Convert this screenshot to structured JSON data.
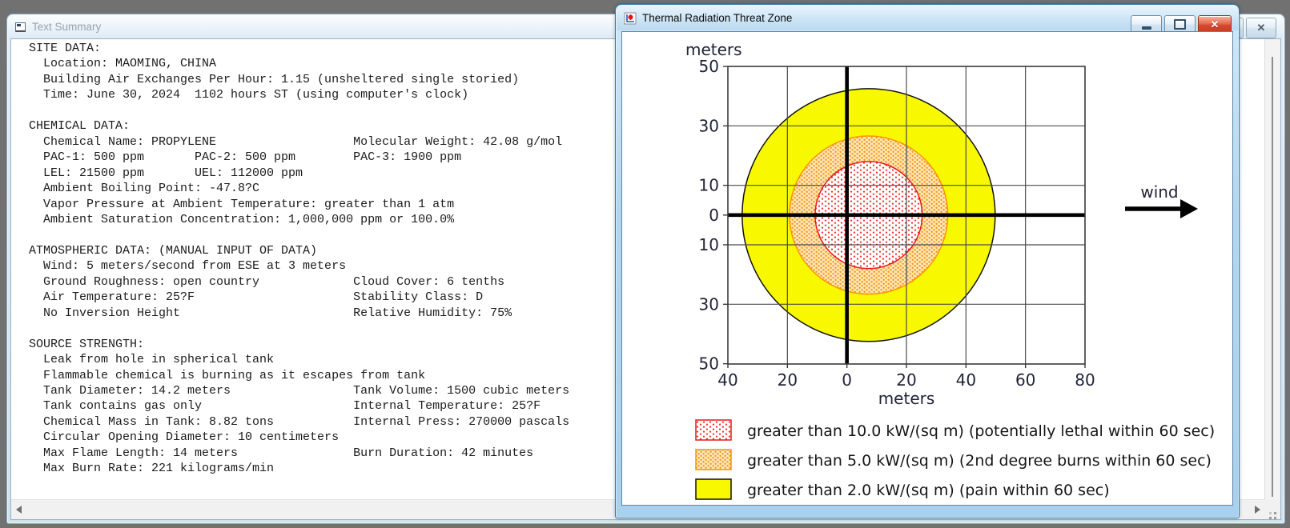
{
  "page": {
    "background": "#717171"
  },
  "text_summary_window": {
    "title": "Text Summary",
    "close_glyph": "✕",
    "lines": [
      " SITE DATA:",
      "   Location: MAOMING, CHINA",
      "   Building Air Exchanges Per Hour: 1.15 (unsheltered single storied)",
      "   Time: June 30, 2024  1102 hours ST (using computer's clock)",
      "",
      " CHEMICAL DATA:",
      "   Chemical Name: PROPYLENE                   Molecular Weight: 42.08 g/mol",
      "   PAC-1: 500 ppm       PAC-2: 500 ppm        PAC-3: 1900 ppm",
      "   LEL: 21500 ppm       UEL: 112000 ppm",
      "   Ambient Boiling Point: -47.8?C",
      "   Vapor Pressure at Ambient Temperature: greater than 1 atm",
      "   Ambient Saturation Concentration: 1,000,000 ppm or 100.0%",
      "",
      " ATMOSPHERIC DATA: (MANUAL INPUT OF DATA)",
      "   Wind: 5 meters/second from ESE at 3 meters",
      "   Ground Roughness: open country             Cloud Cover: 6 tenths",
      "   Air Temperature: 25?F                      Stability Class: D",
      "   No Inversion Height                        Relative Humidity: 75%",
      "",
      " SOURCE STRENGTH:",
      "   Leak from hole in spherical tank",
      "   Flammable chemical is burning as it escapes from tank",
      "   Tank Diameter: 14.2 meters                 Tank Volume: 1500 cubic meters",
      "   Tank contains gas only                     Internal Temperature: 25?F",
      "   Chemical Mass in Tank: 8.82 tons           Internal Press: 270000 pascals",
      "   Circular Opening Diameter: 10 centimeters",
      "   Max Flame Length: 14 meters                Burn Duration: 42 minutes",
      "   Max Burn Rate: 221 kilograms/min"
    ]
  },
  "threat_zone_window": {
    "title": "Thermal Radiation Threat Zone",
    "close_glyph": "✕"
  },
  "chart_data": {
    "type": "threat_zone_plot",
    "title": "Thermal Radiation Threat Zone",
    "wind_label": "wind",
    "x_axis": {
      "label": "meters",
      "range_m": [
        -40,
        80
      ],
      "ticks": [
        {
          "label": "40",
          "m": -40
        },
        {
          "label": "20",
          "m": -20
        },
        {
          "label": "0",
          "m": 0
        },
        {
          "label": "20",
          "m": 20
        },
        {
          "label": "40",
          "m": 40
        },
        {
          "label": "60",
          "m": 60
        },
        {
          "label": "80",
          "m": 80
        }
      ]
    },
    "y_axis": {
      "label": "meters",
      "range_m": [
        -50,
        50
      ],
      "ticks": [
        {
          "label": "50",
          "m": 50
        },
        {
          "label": "30",
          "m": 30
        },
        {
          "label": "10",
          "m": 10
        },
        {
          "label": "0",
          "m": 0
        },
        {
          "label": "10",
          "m": -10
        },
        {
          "label": "30",
          "m": -30
        },
        {
          "label": "50",
          "m": -50
        }
      ]
    },
    "grid": {
      "vertical_m": [
        -20,
        0,
        20,
        40,
        60
      ],
      "horizontal_m": [
        30,
        10,
        -10,
        -30
      ]
    },
    "zones": [
      {
        "id": "lethal",
        "legend": "greater than 10.0 kW/(sq m) (potentially lethal within 60 sec)",
        "threshold_kw_per_sq_m": 10.0,
        "radius_m": 18,
        "center_downwind_m": 7.3,
        "stroke": "#e81818",
        "fill": "red-dots"
      },
      {
        "id": "second-degree-burns",
        "legend": "greater than 5.0 kW/(sq m) (2nd degree burns within 60 sec)",
        "threshold_kw_per_sq_m": 5.0,
        "radius_m": 26.6,
        "center_downwind_m": 7.3,
        "stroke": "#ff9300",
        "fill": "orange-dots"
      },
      {
        "id": "pain",
        "legend": "greater than 2.0 kW/(sq m) (pain within 60 sec)",
        "threshold_kw_per_sq_m": 2.0,
        "radius_m": 42.5,
        "center_downwind_m": 7.3,
        "stroke": "#111111",
        "fill": "#f8f800"
      }
    ]
  }
}
